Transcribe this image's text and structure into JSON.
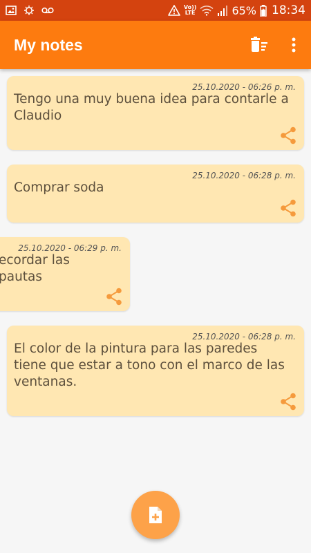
{
  "status_bar": {
    "icons": [
      "image-icon",
      "sync-icon",
      "voicemail-icon",
      "warning-icon",
      "volte-icon",
      "wifi-icon",
      "signal-icon",
      "battery-icon"
    ],
    "volte_text_top": "Vo))",
    "volte_text_bottom": "LTE",
    "battery": "65%",
    "time": "18:34"
  },
  "app_bar": {
    "title": "My notes",
    "background": "#fd7b0f",
    "actions": [
      "delete-sweep-icon",
      "more-vert-icon"
    ]
  },
  "notes": [
    {
      "date": "25.10.2020 - 06:26 p. m.",
      "text": "Tengo una muy buena idea para contarle a Claudio"
    },
    {
      "date": "25.10.2020 - 06:28 p. m.",
      "text": "Comprar soda"
    },
    {
      "date": "25.10.2020 - 06:29 p. m.",
      "text": "ecordar las pautas"
    },
    {
      "date": "25.10.2020 - 06:28 p. m.",
      "text": "El color de la pintura para las paredes tiene que estar a tono con el marco de las ventanas."
    }
  ],
  "colors": {
    "accent": "#fd7b0f",
    "status_bar": "#d4430f",
    "note_card": "#ffe7b2",
    "share_icon": "#f59a3c",
    "fab": "#fda249"
  },
  "fab": {
    "icon": "add-note-icon"
  }
}
